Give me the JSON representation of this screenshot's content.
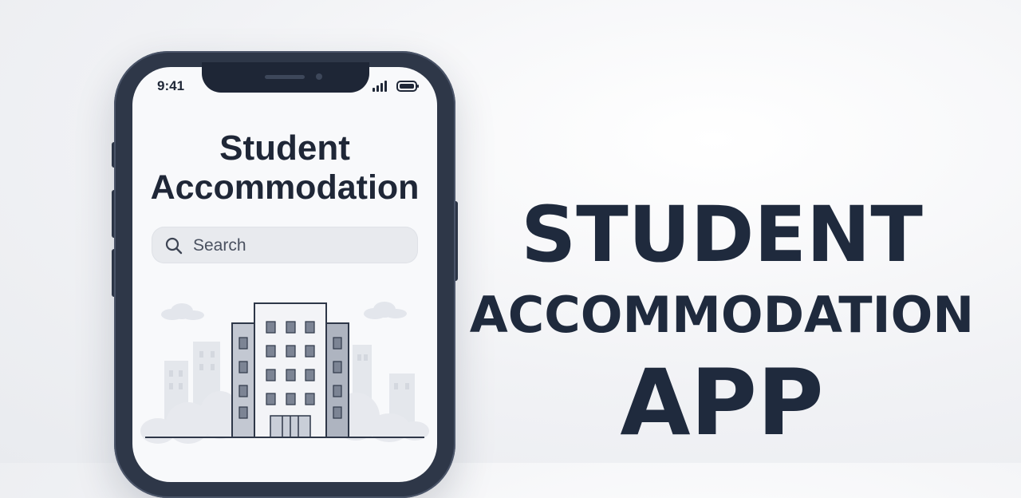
{
  "status_bar": {
    "time": "9:41",
    "signal_icon": "signal-bars-icon",
    "battery_icon": "battery-icon"
  },
  "app": {
    "title_line1": "Student",
    "title_line2": "Accommodation",
    "search": {
      "placeholder": "Search",
      "icon": "search-icon"
    },
    "illustration": "building-illustration"
  },
  "headline": {
    "line1": "STUDENT",
    "line2": "ACCOMMODATION",
    "line3": "APP"
  },
  "colors": {
    "phone_frame": "#2e3748",
    "text_dark": "#1f2737",
    "screen_bg": "#f8f9fb"
  }
}
